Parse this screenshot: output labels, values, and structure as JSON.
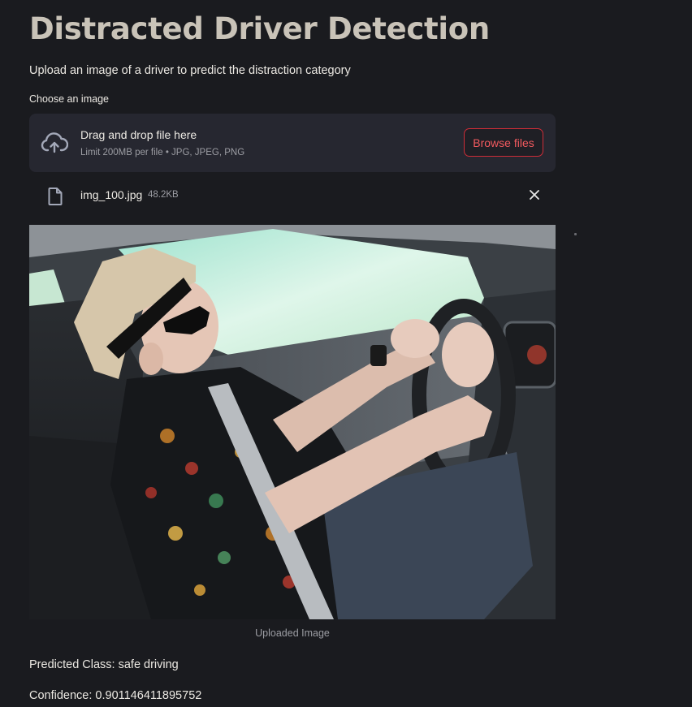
{
  "page": {
    "title": "Distracted Driver Detection",
    "subtitle": "Upload an image of a driver to predict the distraction category"
  },
  "uploader": {
    "label": "Choose an image",
    "drop_text": "Drag and drop file here",
    "limit_text": "Limit 200MB per file • JPG, JPEG, PNG",
    "browse_label": "Browse files",
    "upload_icon": "cloud-upload-icon"
  },
  "uploaded_file": {
    "name": "img_100.jpg",
    "size": "48.2KB",
    "file_icon": "file-icon",
    "remove_icon": "close-icon"
  },
  "image": {
    "caption": "Uploaded Image"
  },
  "results": {
    "predicted_class": "Predicted Class: safe driving",
    "confidence": "Confidence: 0.901146411895752"
  },
  "colors": {
    "background": "#1a1b1f",
    "dropzone": "#262730",
    "accent": "#ce2d38",
    "accent_text": "#f25a5f",
    "title": "#c9c3b8",
    "muted": "#9c9da3"
  }
}
